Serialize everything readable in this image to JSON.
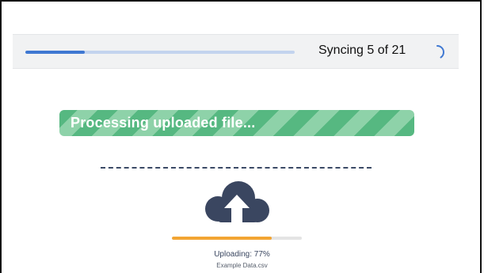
{
  "sync": {
    "text": "Syncing 5 of 21",
    "progress": 0.22
  },
  "processing": {
    "label": "Processing uploaded file..."
  },
  "upload": {
    "status": "Uploading: 77%",
    "progress": 0.77,
    "filename": "Example Data.csv",
    "icon": "cloud-upload-icon"
  },
  "colors": {
    "sync_fill": "#3f78d2",
    "sync_track": "#c3d4ee",
    "processing_green": "#56b881",
    "upload_fill": "#f2a533",
    "cloud": "#3a4660"
  }
}
